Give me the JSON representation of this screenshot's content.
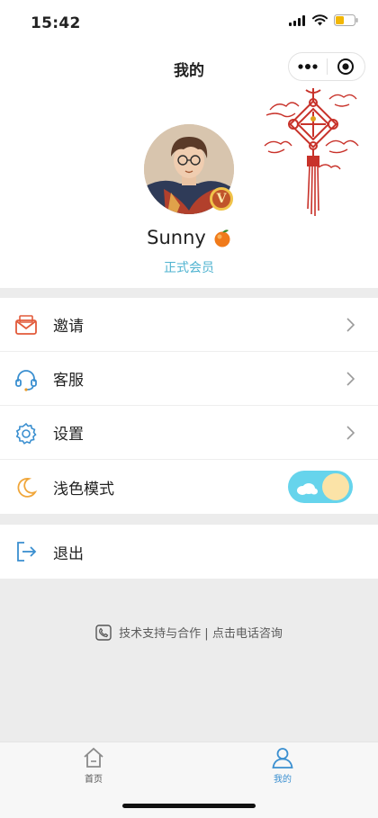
{
  "status_bar": {
    "time": "15:42"
  },
  "header": {
    "title": "我的"
  },
  "profile": {
    "username": "Sunny",
    "member_level": "正式会员",
    "badge": "V"
  },
  "menu": {
    "items": [
      {
        "label": "邀请",
        "icon": "envelope-icon"
      },
      {
        "label": "客服",
        "icon": "headset-icon"
      },
      {
        "label": "设置",
        "icon": "gear-icon"
      },
      {
        "label": "浅色模式",
        "icon": "moon-icon",
        "toggle": true
      }
    ],
    "logout": {
      "label": "退出",
      "icon": "logout-icon"
    }
  },
  "footer": {
    "support_text": "技术支持与合作 | 点击电话咨询"
  },
  "tabbar": {
    "tabs": [
      {
        "label": "首页",
        "icon": "home-icon",
        "active": false
      },
      {
        "label": "我的",
        "icon": "user-icon",
        "active": true
      }
    ]
  },
  "colors": {
    "accent": "#4fb3d0",
    "toggle_bg": "#66d4ec",
    "knot_red": "#c8322a"
  }
}
